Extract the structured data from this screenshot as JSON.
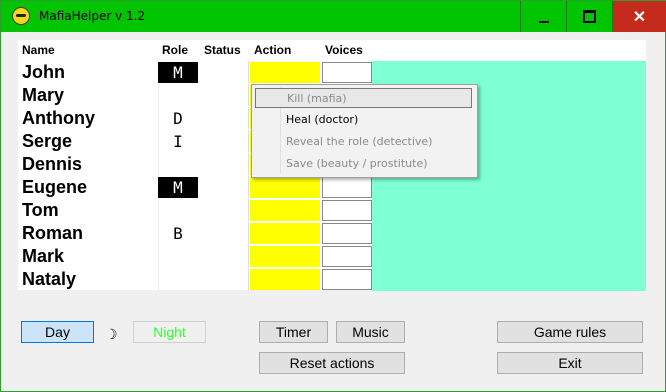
{
  "window": {
    "title": "MafiaHelper v 1.2",
    "controls": {
      "minimize": "—",
      "maximize": "□",
      "close": "✕"
    }
  },
  "headers": {
    "name": "Name",
    "role": "Role",
    "status": "Status",
    "action": "Action",
    "voices": "Voices"
  },
  "players": [
    {
      "name": "John",
      "role": "M",
      "role_dark": true
    },
    {
      "name": "Mary",
      "role": "",
      "role_dark": false
    },
    {
      "name": "Anthony",
      "role": "D",
      "role_dark": false
    },
    {
      "name": "Serge",
      "role": "I",
      "role_dark": false
    },
    {
      "name": "Dennis",
      "role": "",
      "role_dark": false
    },
    {
      "name": "Eugene",
      "role": "M",
      "role_dark": true
    },
    {
      "name": "Tom",
      "role": "",
      "role_dark": false
    },
    {
      "name": "Roman",
      "role": "B",
      "role_dark": false
    },
    {
      "name": "Mark",
      "role": "",
      "role_dark": false
    },
    {
      "name": "Nataly",
      "role": "",
      "role_dark": false
    }
  ],
  "context_menu": {
    "items": [
      {
        "label": "Kill (mafia)",
        "disabled": true,
        "highlighted": true
      },
      {
        "label": "Heal (doctor)",
        "disabled": false,
        "highlighted": false
      },
      {
        "label": "Reveal the role (detective)",
        "disabled": true,
        "highlighted": false
      },
      {
        "label": "Save (beauty / prostitute)",
        "disabled": true,
        "highlighted": false
      }
    ]
  },
  "controls": {
    "day": "Day",
    "moon": "☽",
    "night": "Night",
    "timer": "Timer",
    "music": "Music",
    "reset": "Reset actions",
    "game_rules": "Game rules",
    "exit": "Exit"
  },
  "colors": {
    "titlebar": "#00c400",
    "action_cell": "#ffff00",
    "voices_fill": "#7fffd4",
    "night_text": "#33ff33"
  }
}
